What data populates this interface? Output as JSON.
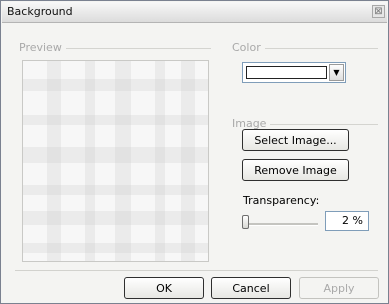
{
  "dialog": {
    "title": "Background",
    "close_glyph": "⊠"
  },
  "preview": {
    "label": "Preview"
  },
  "color": {
    "label": "Color",
    "selected_color": "#ffffff",
    "arrow_glyph": "▼"
  },
  "image": {
    "label": "Image",
    "select_button": "Select Image...",
    "remove_button": "Remove Image"
  },
  "transparency": {
    "label": "Transparency:",
    "value_text": "2 %",
    "value": 2
  },
  "footer": {
    "ok_label": "OK",
    "cancel_label": "Cancel",
    "apply_label": "Apply"
  }
}
